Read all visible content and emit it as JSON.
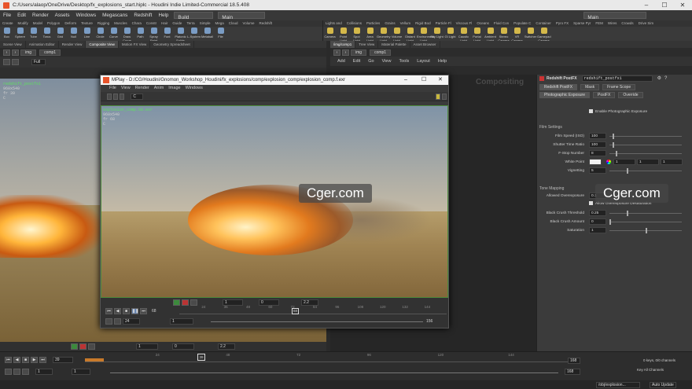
{
  "window": {
    "title": "C:/Users/alaop/OneDrive/Desktop/fx_explosions_start.hiplc - Houdini Indie Limited-Commercial 18.5.408"
  },
  "menubar": {
    "items": [
      "File",
      "Edit",
      "Render",
      "Assets",
      "Windows",
      "Megascans",
      "Redshift",
      "Help"
    ],
    "desktop": "Build",
    "main": "Main",
    "right": "Main"
  },
  "shelf": {
    "tabs_left": [
      "Create",
      "Modify",
      "Model",
      "Polygon",
      "Deform",
      "Texture",
      "Rigging",
      "Muscles",
      "Chara",
      "Constr",
      "Hair",
      "Guide",
      "Terra",
      "Simple",
      "Mega",
      "Cloud",
      "Volume",
      "Redshift"
    ],
    "tabs_right": [
      "Lights and",
      "Collisions",
      "Particles",
      "Grains",
      "Vellum",
      "Rigid Bod",
      "Particle Fl",
      "Viscous Fl",
      "Oceans",
      "Fluid Con",
      "Populate C",
      "Container",
      "Pyro FX",
      "Sparse Pyr",
      "FEM",
      "Wires",
      "Crowds",
      "Drive Sim"
    ],
    "tools_left": [
      "Box",
      "Sphere",
      "Tube",
      "Torus",
      "Grid",
      "Null",
      "Line",
      "Circle",
      "Curve",
      "Draw Curve",
      "Path",
      "Spray Paint",
      "Font",
      "Platonic Solids",
      "L-System",
      "Metaball",
      "File"
    ],
    "tools_right": [
      "Camera",
      "Point Light",
      "Spot Light",
      "Area Light",
      "Geometry Light",
      "Volume Light",
      "Distant Light",
      "Environment Light",
      "Sky Light",
      "GI Light",
      "Caustic Light",
      "Portal Light",
      "Ambient Light",
      "Stereo Camera",
      "VR Camera",
      "Switcher",
      "Gamepad Camera"
    ]
  },
  "left_pane": {
    "tabs": [
      "Scene View",
      "Animation Editor",
      "Render View",
      "Composite View",
      "Motion FX View",
      "Geometry Spreadsheet"
    ],
    "path_root": "img",
    "path_node": "comp1",
    "zoom_mode": "Full",
    "hud": {
      "name": "redshift_postfx1",
      "res": "960x540",
      "frame": "fr 39",
      "channel": "C"
    },
    "ctrl": {
      "value1": "1",
      "value2": "0",
      "gamma": "2.2"
    }
  },
  "right_pane": {
    "tabs": [
      "/img/comp1",
      "Tree View",
      "Material Palette",
      "Asset Browser"
    ],
    "path_root": "img",
    "path_node": "comp1",
    "menu": [
      "Add",
      "Edit",
      "Go",
      "View",
      "Tools",
      "Layout",
      "Help"
    ],
    "network_label": "Compositing"
  },
  "params": {
    "node_type": "Redshift PostFX",
    "node_name": "redshift_postfx1",
    "tabs": [
      "Redshift PostFX",
      "Mask",
      "Frame Scope"
    ],
    "subtabs": [
      "Photographic Exposure",
      "PostFX",
      "Override"
    ],
    "enable_label": "Enable Photographic Exposure",
    "film_settings": "Film Settings",
    "film_speed_label": "Film Speed (ISO)",
    "film_speed": "100",
    "shutter_label": "Shutter Time Ratio",
    "shutter": "100",
    "fstop_label": "F-Stop Number",
    "fstop": "8",
    "white_label": "White Point",
    "white_r": "1",
    "white_g": "1",
    "white_b": "1",
    "vignetting_label": "Vignetting",
    "vignetting": "5",
    "tone_mapping": "Tone Mapping",
    "allowed_over_label": "Allowed Overexposure",
    "allowed_over": "0.1",
    "allow_desat_label": "Allow Overexposure Desaturation",
    "black_crush_thresh_label": "Black Crush Threshold",
    "black_crush_thresh": "0.25",
    "black_crush_amount_label": "Black Crush Amount",
    "black_crush_amount": "0",
    "saturation_label": "Saturation",
    "saturation": "1"
  },
  "mplay": {
    "title": "MPlay - D:/CG/Houdini/Gnomon_Workshop_Houdini/fx_explosions/comp/explosion_comp/explosion_comp.f.exr",
    "menu": [
      "File",
      "View",
      "Render",
      "Anim",
      "Image",
      "Windows"
    ],
    "zoom": "C",
    "hud": {
      "name": "explosion_comp.68.exr",
      "res": "960x540",
      "frame": "fr 68",
      "channel": "C"
    },
    "ctrl": {
      "value1": "1",
      "value2": "0",
      "gamma": "2.2",
      "frame": "68",
      "start": "24",
      "end": "156",
      "current_marker": "68",
      "range_start": "1"
    },
    "ticks": [
      "24",
      "36",
      "48",
      "60",
      "72",
      "84",
      "96",
      "108",
      "120",
      "132",
      "144"
    ]
  },
  "watermark": "Cger.com",
  "timeline": {
    "frame": "39",
    "start": "1",
    "end": "168",
    "range_start": "1",
    "range_end": "168",
    "ticks": [
      "24",
      "48",
      "72",
      "96",
      "120",
      "144"
    ],
    "marker": "39",
    "keys_label": "0 keys, 0/0 channels",
    "key_all_label": "Key All Channels",
    "path": "/obj/explosion...",
    "auto_update": "Auto Update"
  }
}
